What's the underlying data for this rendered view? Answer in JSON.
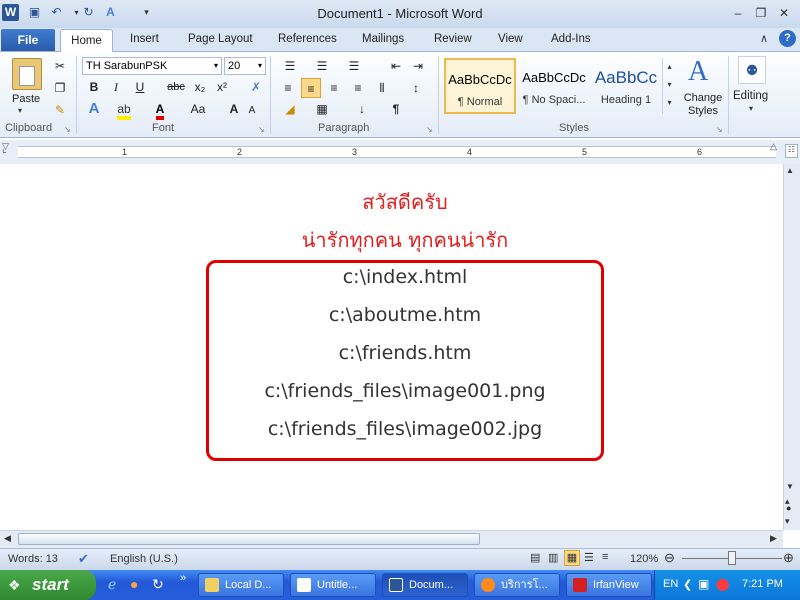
{
  "window": {
    "title": "Document1  -  Microsoft Word"
  },
  "tabs": {
    "file": "File",
    "home": "Home",
    "items": [
      "Insert",
      "Page Layout",
      "References",
      "Mailings",
      "Review",
      "View",
      "Add-Ins"
    ]
  },
  "ribbon": {
    "clipboard": {
      "paste": "Paste",
      "label": "Clipboard"
    },
    "font": {
      "name": "TH SarabunPSK",
      "size": "20",
      "label": "Font",
      "bold": "B",
      "italic": "I",
      "underline": "U",
      "strike": "abc",
      "sub": "x₂",
      "sup": "x²",
      "grow": "A",
      "case": "Aa"
    },
    "paragraph": {
      "label": "Paragraph",
      "pilcrow": "¶"
    },
    "styles": {
      "label": "Styles",
      "items": [
        {
          "sample": "AaBbCcDc",
          "name": "¶ Normal"
        },
        {
          "sample": "AaBbCcDc",
          "name": "¶ No Spaci..."
        },
        {
          "sample": "AaBbCc",
          "name": "Heading 1"
        }
      ],
      "change": "Change Styles"
    },
    "editing": {
      "label": "Editing"
    }
  },
  "ruler": {
    "numbers": [
      "1",
      "2",
      "3",
      "4",
      "5",
      "6"
    ]
  },
  "document": {
    "greeting": "สวัสดีครับ",
    "subtitle": "น่ารักทุกคน ทุกคนน่ารัก",
    "paths": [
      "c:\\index.html",
      "c:\\aboutme.htm",
      "c:\\friends.htm",
      "c:\\friends_files\\image001.png",
      "c:\\friends_files\\image002.jpg"
    ]
  },
  "status": {
    "words": "Words: 13",
    "language": "English (U.S.)",
    "zoom": "120%"
  },
  "taskbar": {
    "start": "start",
    "tasks": [
      "Local D...",
      "Untitle...",
      "Docum...",
      "บริการโ...",
      "IrfanView"
    ],
    "lang": "EN",
    "time": "7:21 PM"
  },
  "colors": {
    "accent": "#2a5bab",
    "doc_text": "#e02020",
    "box": "#e00000"
  }
}
